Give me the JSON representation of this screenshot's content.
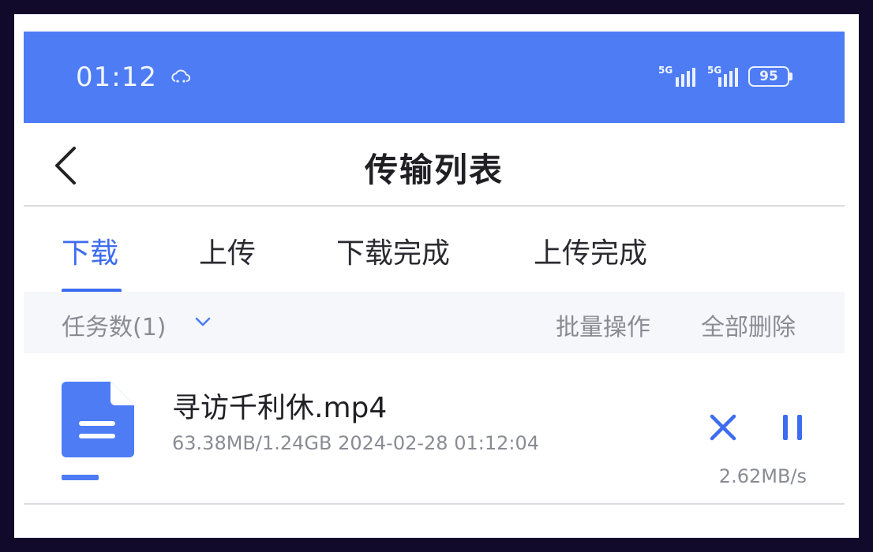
{
  "status_bar": {
    "time": "01:12",
    "cloud_icon": "cloud-sync-icon",
    "signal_1_label": "5G",
    "signal_2_label": "5G",
    "battery_level": "95"
  },
  "header": {
    "back_icon": "chevron-left-icon",
    "title": "传输列表"
  },
  "tabs": [
    {
      "label": "下载",
      "active": true
    },
    {
      "label": "上传",
      "active": false
    },
    {
      "label": "下载完成",
      "active": false
    },
    {
      "label": "上传完成",
      "active": false
    }
  ],
  "taskbar": {
    "task_count": "任务数(1)",
    "batch_label": "批量操作",
    "delete_all_label": "全部删除"
  },
  "file": {
    "icon": "document-icon",
    "name": "寻访千利休.mp4",
    "meta": "63.38MB/1.24GB 2024-02-28 01:12:04",
    "progress": 0.05,
    "speed": "2.62MB/s",
    "cancel_icon": "close-icon",
    "pause_icon": "pause-icon"
  },
  "colors": {
    "accent": "#4d7cf5",
    "active_tab": "#3d6cf0",
    "status_bar": "#4d7cf5",
    "border": "#120a2a"
  }
}
